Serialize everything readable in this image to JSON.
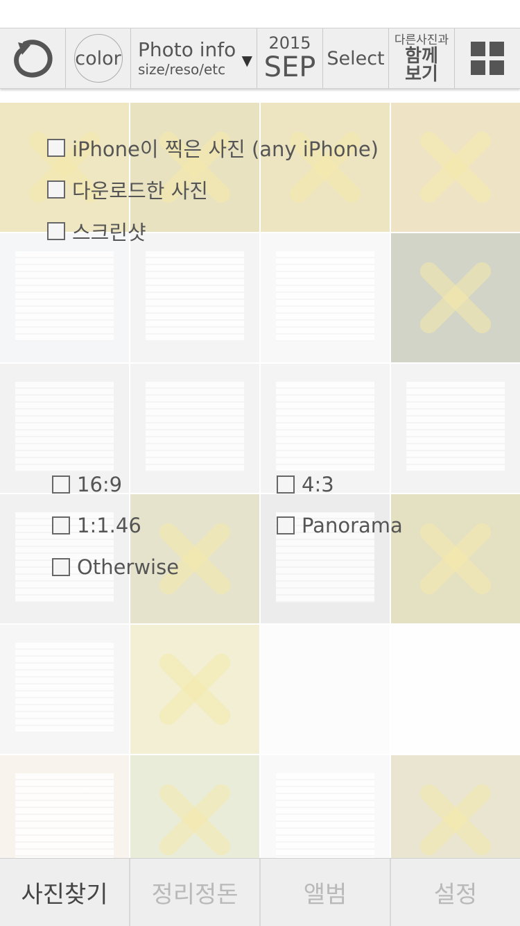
{
  "toolbar": {
    "undo_icon": "undo-icon",
    "color_label": "color",
    "photo_info_title": "Photo info",
    "photo_info_sub": "size/reso/etc",
    "dropdown_icon": "caret-down-icon",
    "year": "2015",
    "month": "SEP",
    "select_label": "Select",
    "other_line1": "다른사진과",
    "other_line2": "함께",
    "other_line3": "보기",
    "grid_icon": "grid-icon"
  },
  "filters": {
    "source": [
      {
        "label": "iPhone이 찍은 사진 (any iPhone)",
        "checked": false
      },
      {
        "label": "다운로드한 사진",
        "checked": false
      },
      {
        "label": "스크린샷",
        "checked": false
      }
    ],
    "ratio": [
      {
        "label": "16:9",
        "checked": false
      },
      {
        "label": "4:3",
        "checked": false
      },
      {
        "label": "1:1.46",
        "checked": false
      },
      {
        "label": "Panorama",
        "checked": false
      },
      {
        "label": "Otherwise",
        "checked": false
      }
    ]
  },
  "tabs": [
    {
      "label": "사진찾기",
      "active": true
    },
    {
      "label": "정리정돈",
      "active": false
    },
    {
      "label": "앨범",
      "active": false
    },
    {
      "label": "설정",
      "active": false
    }
  ],
  "colors": {
    "toolbar_bg": "#efefef",
    "mark_yellow": "#e8ce46",
    "tab_active": "#444444",
    "tab_inactive": "#b9b9b9"
  }
}
